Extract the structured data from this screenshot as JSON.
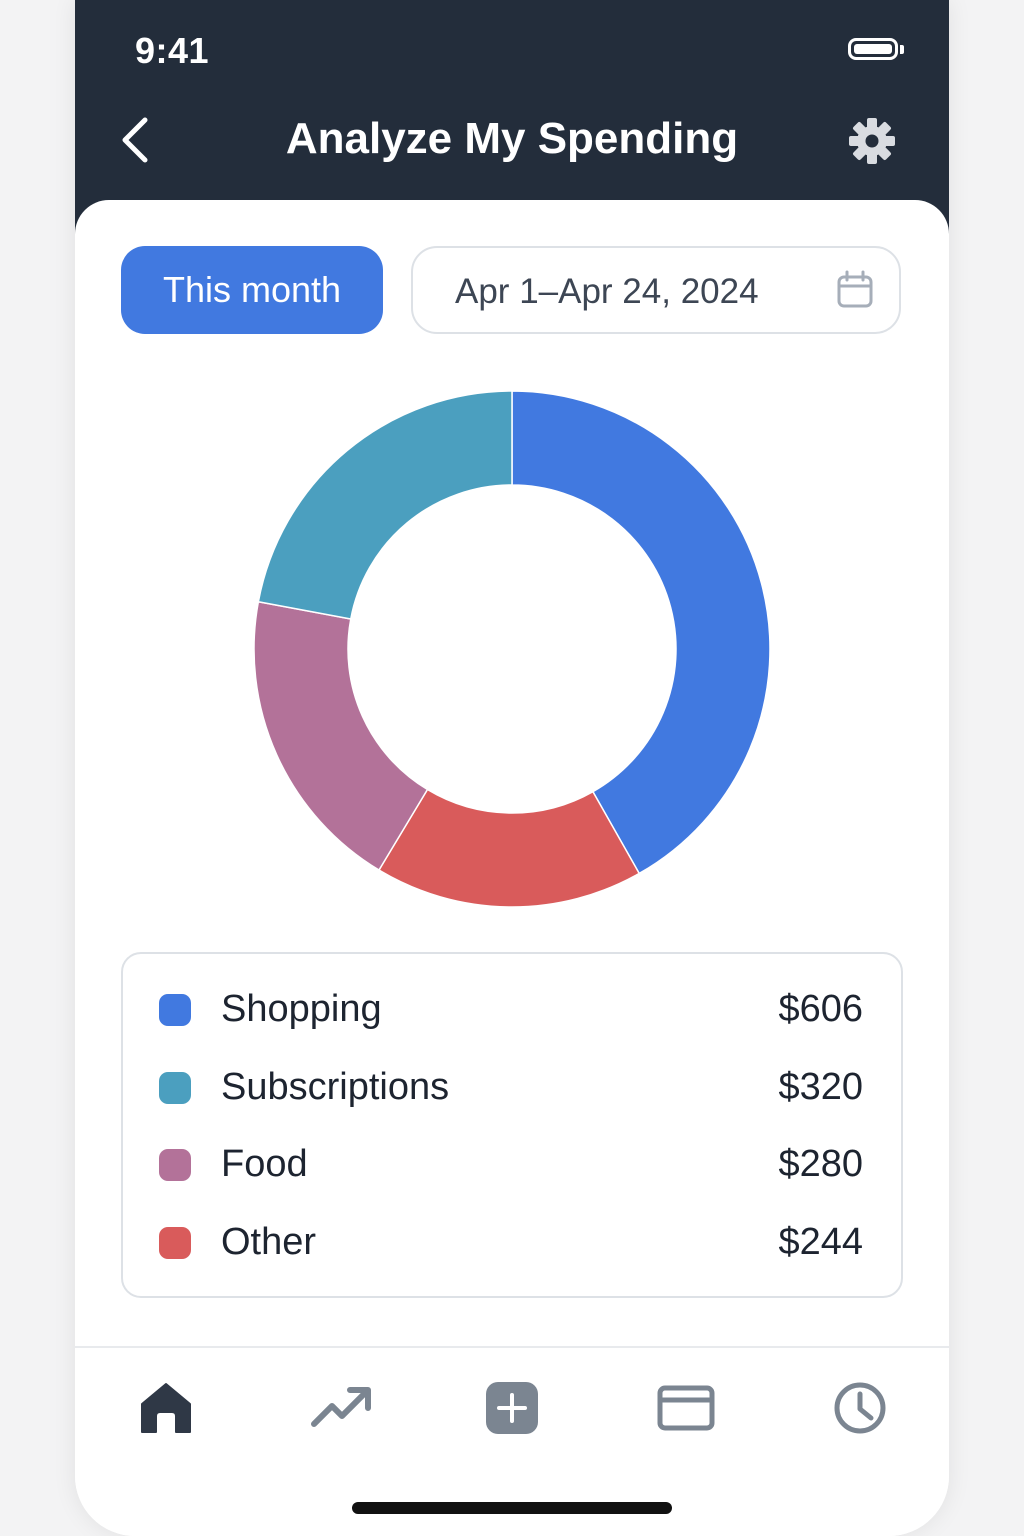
{
  "status_bar": {
    "time": "9:41"
  },
  "header": {
    "title": "Analyze My Spending",
    "back_icon": "chevron-left-icon",
    "settings_icon": "gear-icon"
  },
  "filters": {
    "period_button": "This month",
    "date_range": "Apr 1–Apr 24, 2024",
    "date_icon": "calendar-icon"
  },
  "chart_data": {
    "type": "pie",
    "categories": [
      "Shopping",
      "Subscriptions",
      "Food",
      "Other"
    ],
    "values": [
      606,
      320,
      280,
      244
    ],
    "colors": [
      "#4179e0",
      "#4b9fbf",
      "#b37299",
      "#d95b5b"
    ]
  },
  "legend": {
    "items": [
      {
        "label": "Shopping",
        "value": "$606",
        "color": "#4179e0"
      },
      {
        "label": "Subscriptions",
        "value": "$320",
        "color": "#4b9fbf"
      },
      {
        "label": "Food",
        "value": "$280",
        "color": "#b37299"
      },
      {
        "label": "Other",
        "value": "$244",
        "color": "#d95b5b"
      }
    ]
  },
  "tab_bar": {
    "active": "home",
    "items": [
      "home-icon",
      "trending-up-icon",
      "add-icon",
      "card-icon",
      "clock-icon"
    ]
  },
  "colors": {
    "header_bg": "#232d3b",
    "accent": "#4179e0",
    "donut_top_left_slice": "#4f8ad9"
  }
}
